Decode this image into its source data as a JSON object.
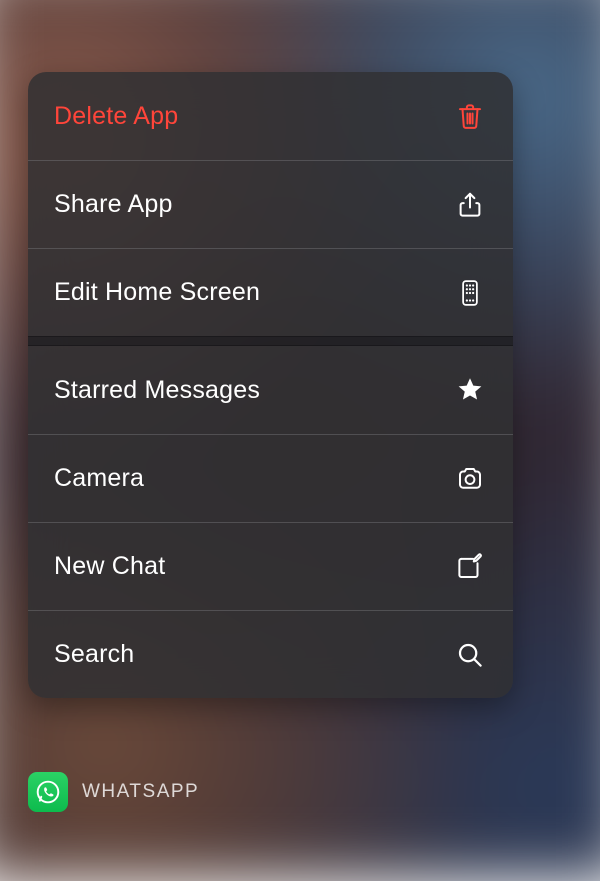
{
  "menu": {
    "system": [
      {
        "id": "delete",
        "label": "Delete App",
        "icon": "trash-icon",
        "destructive": true
      },
      {
        "id": "share",
        "label": "Share App",
        "icon": "share-icon",
        "destructive": false
      },
      {
        "id": "edit",
        "label": "Edit Home Screen",
        "icon": "apps-icon",
        "destructive": false
      }
    ],
    "app": [
      {
        "id": "starred",
        "label": "Starred Messages",
        "icon": "star-icon"
      },
      {
        "id": "camera",
        "label": "Camera",
        "icon": "camera-icon"
      },
      {
        "id": "newchat",
        "label": "New Chat",
        "icon": "compose-icon"
      },
      {
        "id": "search",
        "label": "Search",
        "icon": "search-icon"
      }
    ]
  },
  "app_chip": {
    "name": "WHATSAPP",
    "icon": "whatsapp-icon"
  },
  "colors": {
    "destructive": "#ff453a",
    "text": "#ffffff",
    "whatsapp_green": "#25D366"
  }
}
